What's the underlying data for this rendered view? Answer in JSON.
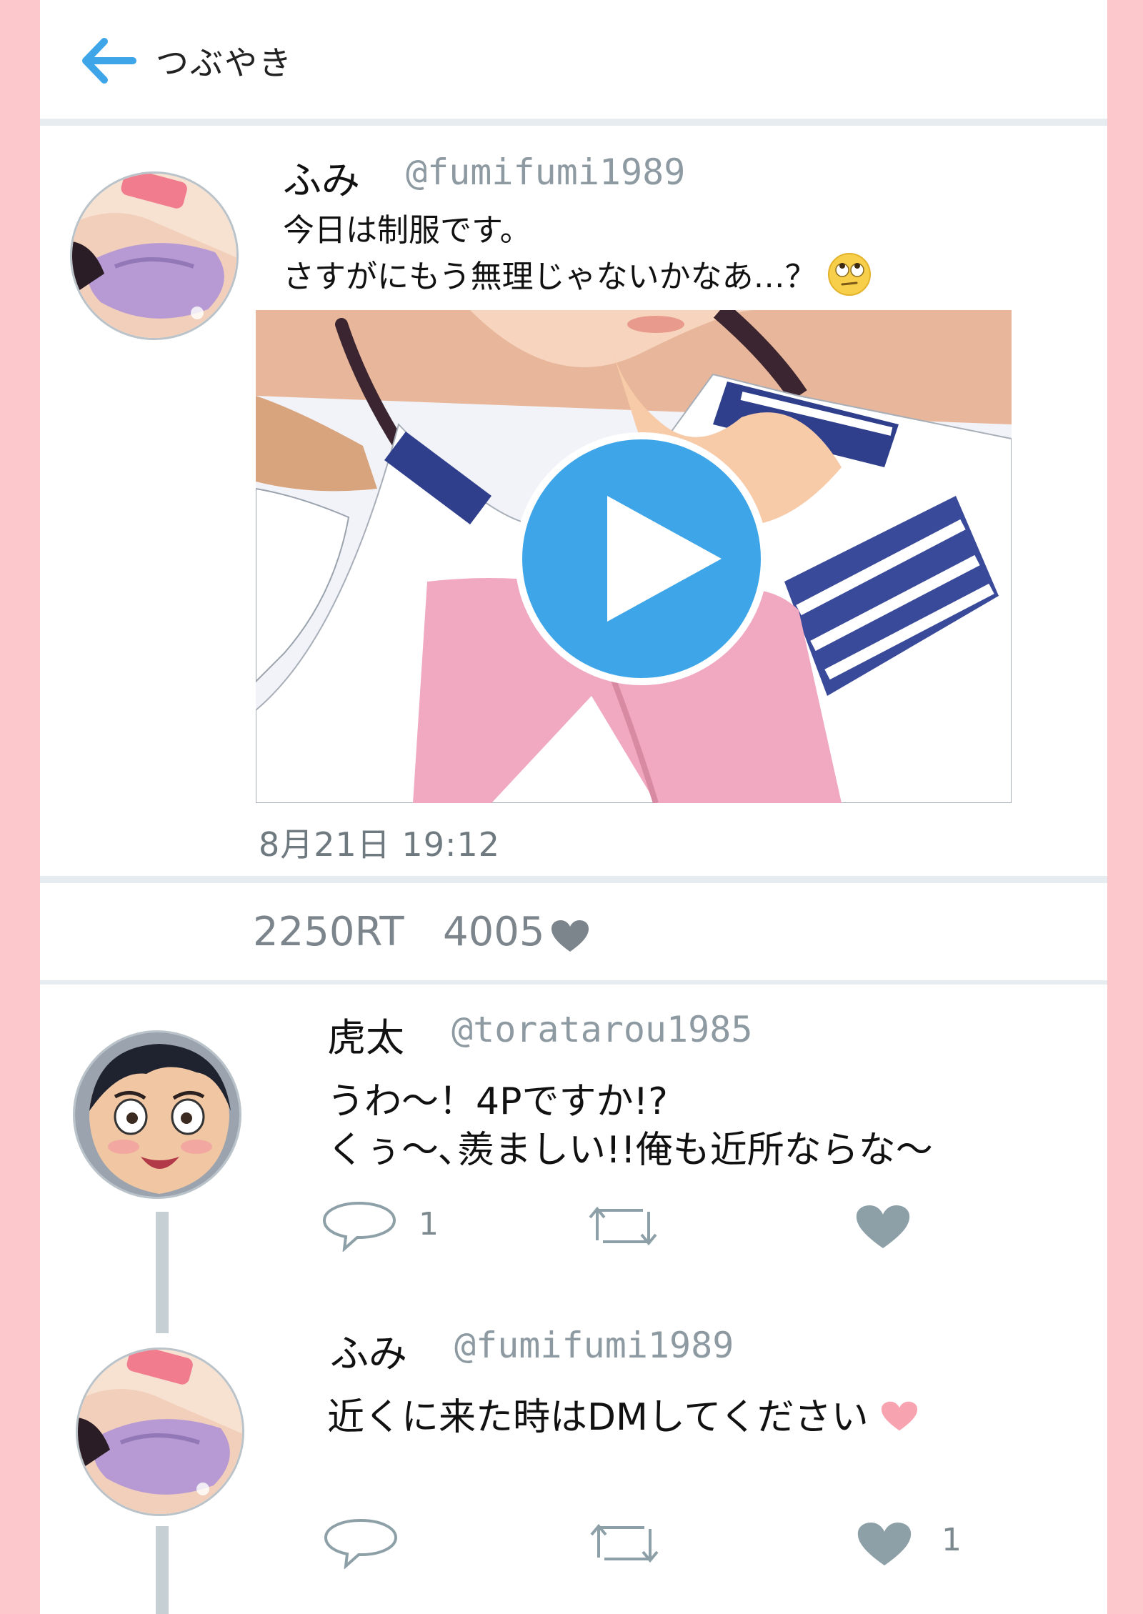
{
  "header": {
    "title": "つぶやき"
  },
  "tweet": {
    "name": "ふみ",
    "handle": "@fumifumi1989",
    "text_line1": "今日は制服です。",
    "text_line2": "さすがにもう無理じゃないかなあ…？",
    "timestamp": "8月21日 19:12",
    "retweets": "2250RT",
    "likes": "4005"
  },
  "replies": [
    {
      "name": "虎太",
      "handle": "@toratarou1985",
      "text_line1": "うわ～！4Pですか!?",
      "text_line2": "くぅ～､羨ましい!!俺も近所ならな～",
      "reply_count": "1",
      "like_count": ""
    },
    {
      "name": "ふみ",
      "handle": "@fumifumi1989",
      "text_line1": "近くに来た時はDMしてください",
      "text_line2": "",
      "reply_count": "",
      "like_count": "1"
    }
  ],
  "colors": {
    "accent": "#3ea6e8",
    "background": "#fcc8cc",
    "heart_pink": "#f7a3b0",
    "icon_gray": "#8ea0a7"
  },
  "icons": [
    "back-arrow-icon",
    "play-icon",
    "heart-icon",
    "reply-icon",
    "retweet-icon",
    "eye-roll-emoji-icon"
  ]
}
